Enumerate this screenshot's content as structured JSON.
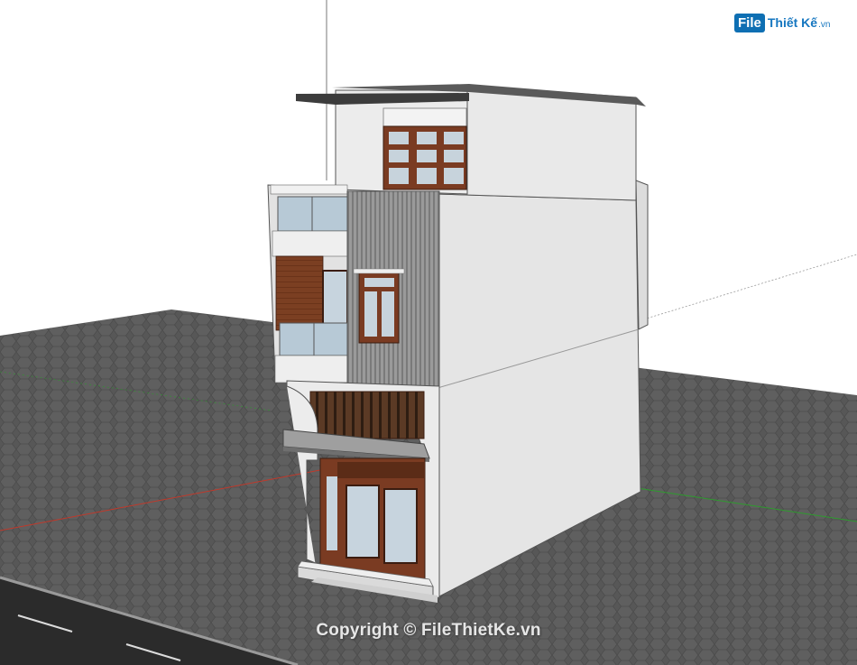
{
  "watermark": {
    "logo_box": "File",
    "logo_name": "Thiết Kế",
    "logo_tld": ".vn",
    "copyright": "Copyright © FileThietKe.vn"
  },
  "scene": {
    "subject": "house-3d-model",
    "colors": {
      "ground": "#595959",
      "wall": "#e9e9e9",
      "wood": "#7a3b22",
      "glass": "#b9cbd6",
      "metal_cladding": "#8c8c8c",
      "sky": "#ffffff"
    }
  }
}
